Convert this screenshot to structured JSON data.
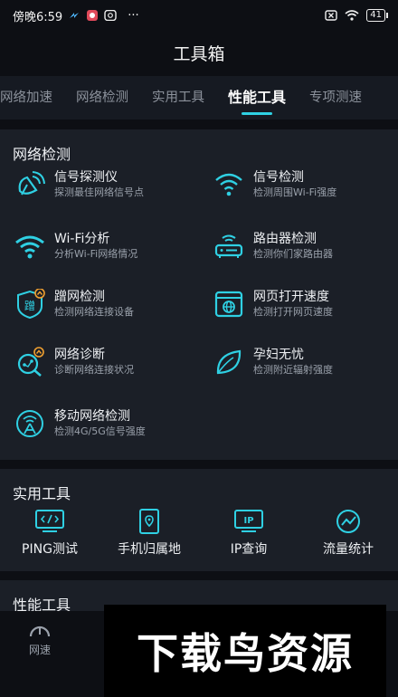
{
  "status_bar": {
    "time": "傍晚6:59",
    "battery": "41",
    "dots": "···"
  },
  "header": {
    "title": "工具箱"
  },
  "tabs": [
    {
      "label": "网络加速"
    },
    {
      "label": "网络检测"
    },
    {
      "label": "实用工具"
    },
    {
      "label": "性能工具",
      "active": true
    },
    {
      "label": "专项测速"
    }
  ],
  "network_section": {
    "title": "网络检测",
    "items": [
      {
        "title": "信号探测仪",
        "desc": "探测最佳网络信号点",
        "icon": "satellite-dish-icon"
      },
      {
        "title": "信号检测",
        "desc": "检测周围Wi-Fi强度",
        "icon": "wifi-signal-icon"
      },
      {
        "title": "Wi-Fi分析",
        "desc": "分析Wi-Fi网络情况",
        "icon": "wifi-icon"
      },
      {
        "title": "路由器检测",
        "desc": "检测你们家路由器",
        "icon": "router-icon"
      },
      {
        "title": "蹭网检测",
        "desc": "检测网络连接设备",
        "icon": "freeloader-shield-icon",
        "icon_char": "蹭"
      },
      {
        "title": "网页打开速度",
        "desc": "检测打开网页速度",
        "icon": "browser-globe-icon"
      },
      {
        "title": "网络诊断",
        "desc": "诊断网络连接状况",
        "icon": "network-diagnosis-icon"
      },
      {
        "title": "孕妇无忧",
        "desc": "检测附近辐射强度",
        "icon": "leaf-icon"
      },
      {
        "title": "移动网络检测",
        "desc": "检测4G/5G信号强度",
        "icon": "cell-tower-icon"
      }
    ]
  },
  "util_section": {
    "title": "实用工具",
    "items": [
      {
        "label": "PING测试",
        "icon": "code-monitor-icon"
      },
      {
        "label": "手机归属地",
        "icon": "phone-location-icon"
      },
      {
        "label": "IP查询",
        "icon": "ip-monitor-icon",
        "icon_text": "IP"
      },
      {
        "label": "流量统计",
        "icon": "traffic-chart-icon"
      }
    ]
  },
  "perf_section": {
    "title": "性能工具"
  },
  "bottom_nav": {
    "speed_label": "网速",
    "dots": "⋮"
  },
  "watermark": {
    "text": "下载鸟资源"
  },
  "colors": {
    "accent": "#2fd0e3",
    "background": "#0d0f14",
    "card": "#1b1f27",
    "badge": "#f0a030"
  }
}
